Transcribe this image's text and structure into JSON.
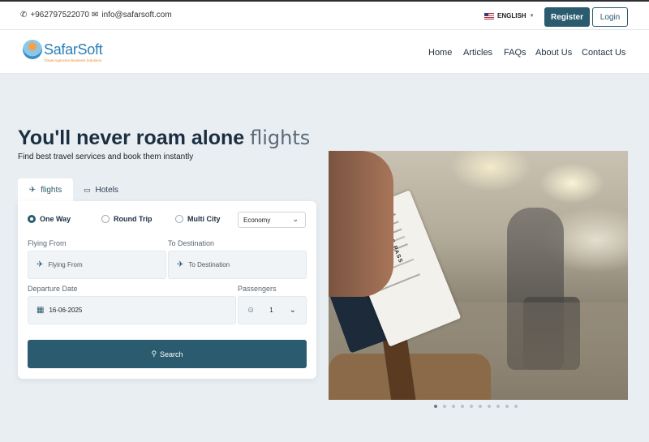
{
  "topbar": {
    "phone": "+962797522070",
    "email": "info@safarsoft.com",
    "language": "ENGLISH",
    "register_label": "Register",
    "login_label": "Login"
  },
  "brand": {
    "name": "SafarSoft",
    "tagline": "Travel Agencies Business Solutions"
  },
  "nav": [
    "Home",
    "Articles",
    "FAQs",
    "About Us",
    "Contact Us"
  ],
  "hero": {
    "title_bold": "You'll never roam alone",
    "title_light": "flights",
    "subtitle": "Find best travel services and book them instantly"
  },
  "tabs": [
    {
      "label": "flights",
      "active": true
    },
    {
      "label": "Hotels",
      "active": false
    }
  ],
  "trip_types": [
    {
      "label": "One Way",
      "selected": true
    },
    {
      "label": "Round Trip",
      "selected": false
    },
    {
      "label": "Multi City",
      "selected": false
    }
  ],
  "cabin_class": "Economy",
  "form": {
    "from_label": "Flying From",
    "from_placeholder": "Flying From",
    "to_label": "To Destination",
    "to_placeholder": "To Destination",
    "departure_label": "Departure Date",
    "departure_value": "16-06-2025",
    "passengers_label": "Passengers",
    "passengers_value": "1",
    "search_label": "Search"
  },
  "photo": {
    "pass_text": "BOARDING PASS"
  },
  "carousel": {
    "slide_count": 10,
    "active_index": 0
  },
  "colors": {
    "primary": "#2b5b6e",
    "background": "#e9eef3"
  }
}
